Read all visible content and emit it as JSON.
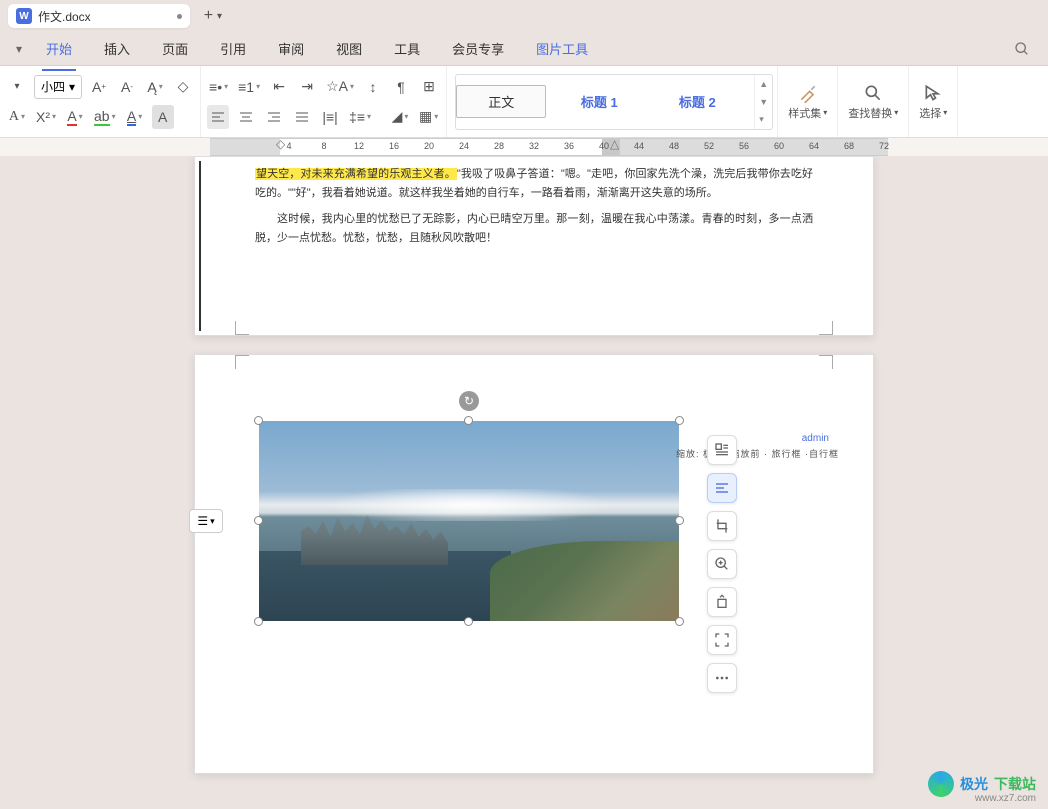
{
  "titlebar": {
    "icon_letter": "W",
    "filename": "作文.docx",
    "newtab_plus": "+"
  },
  "menubar": {
    "file_dd": "▾",
    "items": [
      "开始",
      "插入",
      "页面",
      "引用",
      "审阅",
      "视图",
      "工具",
      "会员专享",
      "图片工具"
    ],
    "active_index": 0
  },
  "toolbar": {
    "font_size": "小四",
    "styles": {
      "item1": "正文",
      "item2": "标题 1",
      "item3": "标题 2"
    },
    "right": {
      "styleset": "样式集",
      "findreplace": "查找替换",
      "select": "选择"
    }
  },
  "ruler": {
    "ticks": [
      "4",
      "8",
      "12",
      "16",
      "20",
      "24",
      "28",
      "32",
      "36",
      "40",
      "44",
      "48",
      "52",
      "56",
      "60",
      "64",
      "68",
      "72"
    ]
  },
  "doc": {
    "p1_hl": "望天空，对未来充满希望的乐观主义者。",
    "p1_tail": "\"我吸了吸鼻子答道：\"嗯。\"走吧，你回家先洗个澡，洗完后我带你去吃好吃的。\"\"好\"，我看着她说道。就这样我坐着她的自行车，一路看着雨，渐渐离开这失意的场所。",
    "p2": "这时候，我内心里的忧愁已了无踪影，内心已晴空万里。那一刻，温暖在我心中荡漾。青春的时刻，多一点洒脱，少一点忧愁。忧愁，忧愁，且随秋风吹散吧！",
    "comment_author": "admin",
    "comment_ruler": "缩放: 极架 ·缩放前 · 旅行框 ·自行框"
  },
  "pictools": {
    "t1": "wrap-text-icon",
    "t2": "align-icon",
    "t3": "crop-icon",
    "t4": "zoom-icon",
    "t5": "rotate-icon",
    "t6": "fullscreen-icon",
    "t7": "more-icon"
  },
  "watermark": {
    "name1": "极光",
    "name2": "下载站",
    "url": "www.xz7.com"
  }
}
